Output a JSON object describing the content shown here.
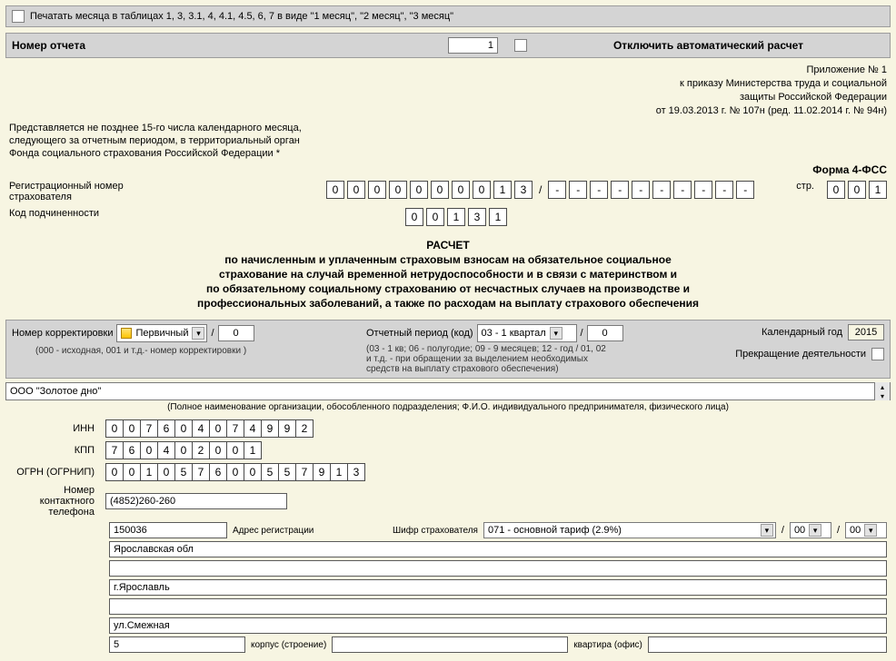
{
  "checkboxes": {
    "print_months_label": "Печатать месяца в таблицах 1, 3, 3.1, 4, 4.1, 4.5, 6, 7 в виде \"1 месяц\", \"2 месяц\", \"3 месяц\"",
    "disable_calc_label": "Отключить автоматический расчет"
  },
  "header": {
    "report_number_label": "Номер отчета",
    "report_number_value": "1",
    "appendix": "Приложение № 1",
    "appendix_l2": "к приказу Министерства труда и социальной",
    "appendix_l3": "защиты Российской Федерации",
    "appendix_l4": "от 19.03.2013 г. № 107н (ред. 11.02.2014 г. № 94н)",
    "submission_l1": "Представляется не позднее 15-го числа календарного месяца,",
    "submission_l2": "следующего за отчетным периодом, в территориальный орган",
    "submission_l3": "Фонда социального страхования Российской Федерации *",
    "form_label": "Форма 4-ФСС"
  },
  "reg": {
    "label": "Регистрационный номер страхователя",
    "digits": [
      "0",
      "0",
      "0",
      "0",
      "0",
      "0",
      "0",
      "0",
      "1",
      "3"
    ],
    "sep": "/",
    "after": [
      "-",
      "-",
      "-",
      "-",
      "-",
      "-",
      "-",
      "-",
      "-",
      "-"
    ],
    "page_label": "стр.",
    "page": [
      "0",
      "0",
      "1"
    ]
  },
  "subord": {
    "label": "Код подчиненности",
    "digits": [
      "0",
      "0",
      "1",
      "3",
      "1"
    ]
  },
  "title": {
    "l1": "РАСЧЕТ",
    "l2": "по начисленным и уплаченным страховым взносам на обязательное социальное",
    "l3": "страхование на случай временной нетрудоспособности и в связи с материнством и",
    "l4": "по обязательному социальному страхованию от несчастных случаев на производстве и",
    "l5": "профессиональных заболеваний, а также по расходам на выплату страхового обеспечения"
  },
  "params": {
    "corr_label": "Номер корректировки",
    "corr_type": "Первичный",
    "corr_value": "0",
    "corr_note": "(000 - исходная, 001 и т.д.- номер корректировки )",
    "period_label": "Отчетный период (код)",
    "period_value": "03 - 1 квартал",
    "period_right": "0",
    "period_note1": "(03 - 1 кв; 06 - полугодие; 09 - 9 месяцев; 12 - год / 01, 02",
    "period_note2": "и т.д. - при обращении за выделением необходимых",
    "period_note3": "средств на выплату страхового обеспечения)",
    "year_label": "Календарный год",
    "year_value": "2015",
    "cease_label": "Прекращение деятельности"
  },
  "org": {
    "name": "ООО \"Золотое дно\"",
    "caption": "(Полное наименование организации, обособленного подразделения; Ф.И.О. индивидуального предпринимателя, физического лица)"
  },
  "ids": {
    "inn_label": "ИНН",
    "inn": [
      "0",
      "0",
      "7",
      "6",
      "0",
      "4",
      "0",
      "7",
      "4",
      "9",
      "9",
      "2"
    ],
    "kpp_label": "КПП",
    "kpp": [
      "7",
      "6",
      "0",
      "4",
      "0",
      "2",
      "0",
      "0",
      "1"
    ],
    "ogrn_label": "ОГРН (ОГРНИП)",
    "ogrn": [
      "0",
      "0",
      "1",
      "0",
      "5",
      "7",
      "6",
      "0",
      "0",
      "5",
      "5",
      "7",
      "9",
      "1",
      "3"
    ],
    "phone_label": "Номер контактного телефона",
    "phone": "(4852)260-260"
  },
  "addr": {
    "postcode": "150036",
    "postcode_label": "Адрес регистрации",
    "tarif_label": "Шифр страхователя",
    "tarif": "071 - основной тариф (2.9%)",
    "tarif2": "00",
    "tarif3": "00",
    "region": "Ярославская обл",
    "city": "г.Ярославль",
    "street": "ул.Смежная",
    "house": "5",
    "korpus_label": "корпус (строение)",
    "flat_label": "квартира (офис)"
  }
}
